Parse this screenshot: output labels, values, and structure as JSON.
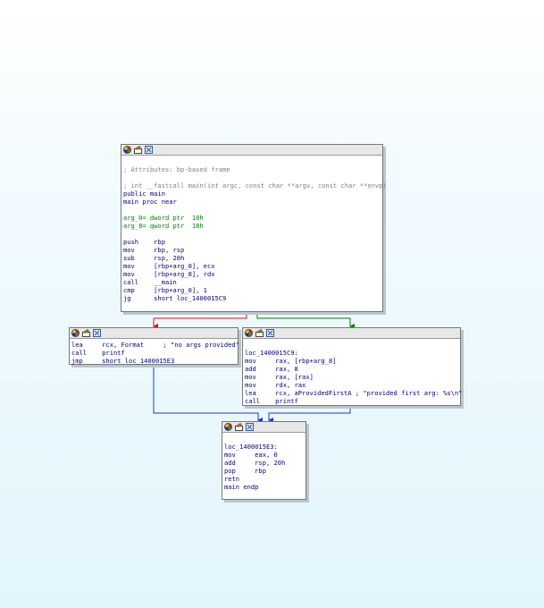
{
  "colors": {
    "edge_true": "#008000",
    "edge_false": "#d01818",
    "edge_uncond": "#1a3ccc",
    "comment": "#808080",
    "code": "#000080",
    "var": "#008000"
  },
  "icons": [
    "color-node-icon",
    "rename-node-icon",
    "group-node-icon"
  ],
  "nodes": {
    "main": {
      "lines": [
        {
          "kind": "blank",
          "text": ""
        },
        {
          "kind": "comment",
          "text": "; Attributes: bp-based frame"
        },
        {
          "kind": "blank",
          "text": ""
        },
        {
          "kind": "comment",
          "text": "; int __fastcall main(int argc, const char **argv, const char **envp)"
        },
        {
          "kind": "code",
          "text": "public main"
        },
        {
          "kind": "code",
          "text": "main proc near"
        },
        {
          "kind": "blank",
          "text": ""
        },
        {
          "kind": "var",
          "text": "arg_0= dword ptr  10h"
        },
        {
          "kind": "var",
          "text": "arg_8= qword ptr  18h"
        },
        {
          "kind": "blank",
          "text": ""
        },
        {
          "kind": "code",
          "text": "push    rbp"
        },
        {
          "kind": "code",
          "text": "mov     rbp, rsp"
        },
        {
          "kind": "code",
          "text": "sub     rsp, 20h"
        },
        {
          "kind": "code",
          "text": "mov     [rbp+arg_0], ecx"
        },
        {
          "kind": "code",
          "text": "mov     [rbp+arg_8], rdx"
        },
        {
          "kind": "code",
          "text": "call    __main"
        },
        {
          "kind": "code",
          "text": "cmp     [rbp+arg_0], 1"
        },
        {
          "kind": "code",
          "text": "jg      short loc_1400015C9"
        }
      ]
    },
    "noargs": {
      "lines": [
        {
          "kind": "code",
          "text": "lea     rcx, Format     ; \"no args provided\""
        },
        {
          "kind": "code",
          "text": "call    printf"
        },
        {
          "kind": "code",
          "text": "jmp     short loc_1400015E3"
        }
      ]
    },
    "loc15c9": {
      "lines": [
        {
          "kind": "blank",
          "text": ""
        },
        {
          "kind": "code",
          "text": "loc_1400015C9:"
        },
        {
          "kind": "code",
          "text": "mov     rax, [rbp+arg_8]"
        },
        {
          "kind": "code",
          "text": "add     rax, 8"
        },
        {
          "kind": "code",
          "text": "mov     rax, [rax]"
        },
        {
          "kind": "code",
          "text": "mov     rdx, rax"
        },
        {
          "kind": "code",
          "text": "lea     rcx, aProvidedFirstA ; \"provided first arg: %s\\n\""
        },
        {
          "kind": "code",
          "text": "call    printf"
        }
      ]
    },
    "loc15e3": {
      "lines": [
        {
          "kind": "blank",
          "text": ""
        },
        {
          "kind": "code",
          "text": "loc_1400015E3:"
        },
        {
          "kind": "code",
          "text": "mov     eax, 0"
        },
        {
          "kind": "code",
          "text": "add     rsp, 20h"
        },
        {
          "kind": "code",
          "text": "pop     rbp"
        },
        {
          "kind": "code",
          "text": "retn"
        },
        {
          "kind": "code",
          "text": "main endp"
        }
      ]
    }
  }
}
